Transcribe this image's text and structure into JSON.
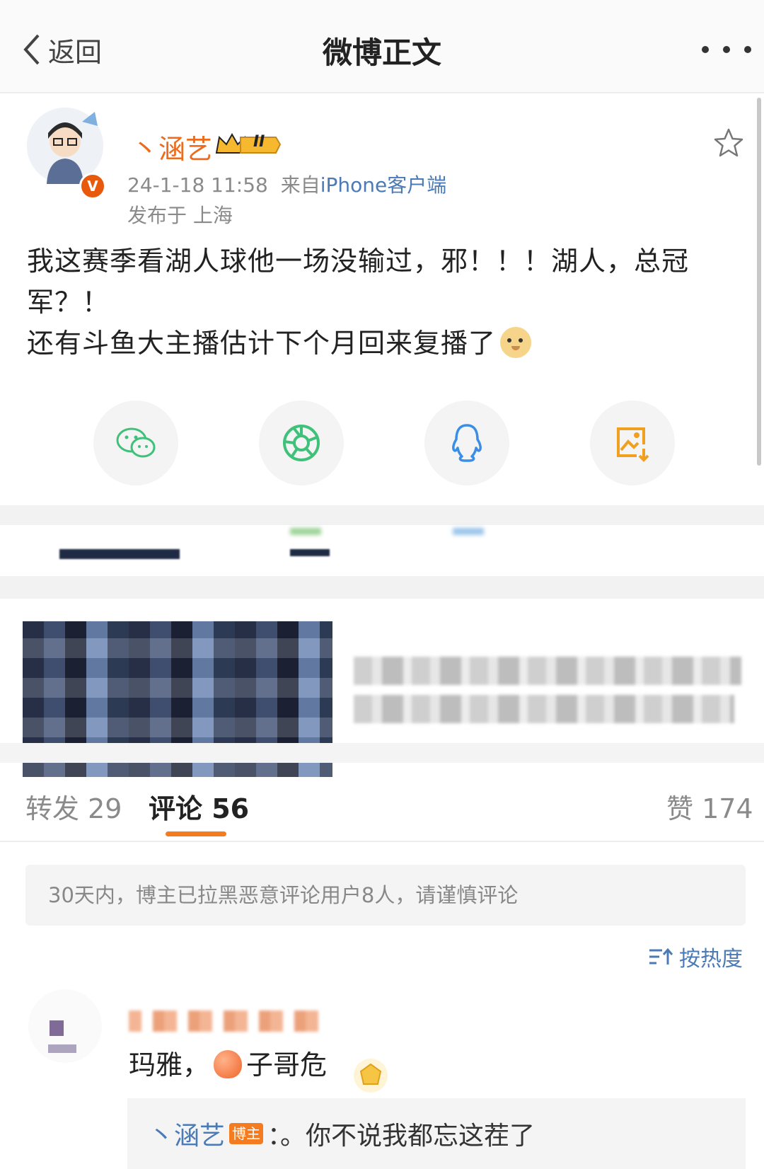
{
  "nav": {
    "back_label": "返回",
    "title": "微博正文"
  },
  "author": {
    "name": "丶涵艺",
    "vip_level": "II",
    "verified_mark": "V"
  },
  "post_meta": {
    "time": "24-1-18 11:58",
    "source_prefix": "来自",
    "source": "iPhone客户端",
    "location": "发布于 上海"
  },
  "post": {
    "line1": "我这赛季看湖人球他一场没输过，邪！！！湖人，总冠军？！",
    "line2": "还有斗鱼大主播估计下个月回来复播了"
  },
  "share_icons": [
    "wechat-icon",
    "moments-icon",
    "qq-icon",
    "save-image-icon"
  ],
  "tabs": {
    "repost": "转发 29",
    "comment": "评论 56",
    "like": "赞 174"
  },
  "notice": "30天内，博主已拉黑恶意评论用户8人，请谨慎评论",
  "sort_label": "按热度",
  "comment": {
    "before": "玛雅，",
    "after": "子哥危"
  },
  "reply": {
    "name": "丶涵艺",
    "badge": "博主",
    "text": "：。你不说我都忘这茬了"
  },
  "colors": {
    "accent": "#f47b20",
    "link": "#4b7bb6",
    "username": "#ec6b1c"
  }
}
